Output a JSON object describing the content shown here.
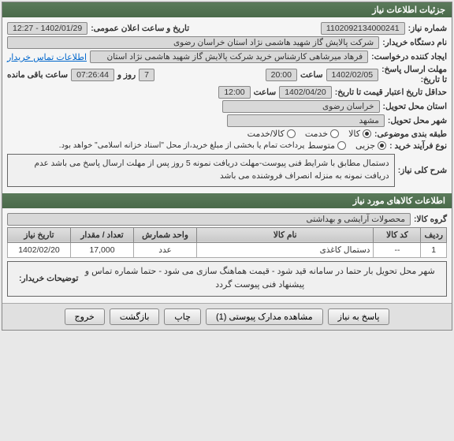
{
  "header": {
    "title": "جزئیات اطلاعات نیاز"
  },
  "details": {
    "needNumberLabel": "شماره نیاز:",
    "needNumber": "1102092134000241",
    "publicDateLabel": "تاریخ و ساعت اعلان عمومی:",
    "publicDate": "1402/01/29 - 12:27",
    "buyerOrgLabel": "نام دستگاه خریدار:",
    "buyerOrg": "شرکت پالایش گاز شهید هاشمی نژاد   استان خراسان رضوی",
    "requesterLabel": "ایجاد کننده درخواست:",
    "requester": "فرهاد میرشاهی کارشناس خرید شرکت پالایش گاز شهید هاشمی نژاد   استان",
    "contactLink": "اطلاعات تماس خریدار",
    "answerDeadlineLabel": "مهلت ارسال پاسخ:",
    "answerDeadlineDate": "1402/02/05",
    "hourLabel": "ساعت",
    "answerDeadlineTime": "20:00",
    "daysLabel": "روز و",
    "daysValue": "7",
    "countdown": "07:26:44",
    "remainingLabel": "ساعت باقی مانده",
    "untilLabel": "تا تاریخ:",
    "priceValidityLabel": "حداقل تاریخ اعتبار قیمت تا تاریخ:",
    "priceValidityDate": "1402/04/20",
    "priceValidityTime": "12:00",
    "provinceLabel": "استان محل تحویل:",
    "province": "خراسان رضوی",
    "cityLabel": "شهر محل تحویل:",
    "city": "مشهد",
    "categoryLabel": "طبقه بندی موضوعی:",
    "catGoods": "کالا",
    "catService": "خدمت",
    "catBoth": "کالا/خدمت",
    "buyTypeLabel": "نوع فرآیند خرید :",
    "buyTypePartial": "جزیی",
    "buyTypeMedium": "متوسط",
    "buyTypeNote": "پرداخت تمام یا بخشی از مبلغ خرید،از محل \"اسناد خزانه اسلامی\" خواهد بود.",
    "needDescLabel": "شرح کلی نیاز:",
    "needDesc": "دستمال مطابق با شرایط فنی پیوست-مهلت دریافت نمونه  5 روز پس از مهلت ارسال پاسخ می باشد عدم دریافت نمونه به منزله انصراف فروشنده می باشد"
  },
  "goods": {
    "title": "اطلاعات کالاهای مورد نیاز",
    "groupLabel": "گروه کالا:",
    "group": "محصولات آرایشی و بهداشتی",
    "columns": {
      "row": "ردیف",
      "code": "کد کالا",
      "name": "نام کالا",
      "unit": "واحد شمارش",
      "qty": "تعداد / مقدار",
      "date": "تاریخ نیاز"
    },
    "rows": [
      {
        "row": "1",
        "code": "--",
        "name": "دستمال کاغذی",
        "unit": "عدد",
        "qty": "17,000",
        "date": "1402/02/20"
      }
    ],
    "buyerNotesLabel": "توضیحات خریدار:",
    "buyerNotes": "شهر محل تحویل بار حتما در سامانه قید شود - قیمت هماهنگ سازی می شود - حتما شماره تماس و پیشنهاد فنی پیوست گردد"
  },
  "buttons": {
    "respond": "پاسخ به نیاز",
    "attachments": "مشاهده مدارک پیوستی (1)",
    "print": "چاپ",
    "back": "بازگشت",
    "exit": "خروج"
  }
}
